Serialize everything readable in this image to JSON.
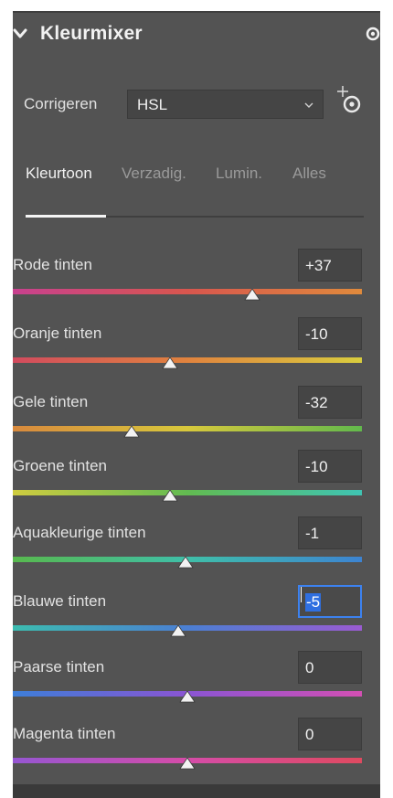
{
  "panel": {
    "title": "Kleurmixer",
    "collapse_icon": "chevron-down-icon",
    "visibility_icon": "eye-icon"
  },
  "correct": {
    "label": "Corrigeren",
    "selected": "HSL",
    "target_tool_icon": "targeted-adjustment-icon"
  },
  "tabs": [
    {
      "label": "Kleurtoon",
      "active": true
    },
    {
      "label": "Verzadig.",
      "active": false
    },
    {
      "label": "Lumin.",
      "active": false
    },
    {
      "label": "Alles",
      "active": false
    }
  ],
  "sliders": [
    {
      "label": "Rode tinten",
      "value": "+37",
      "level": 37,
      "colors": [
        "#c8418f",
        "#d8564e",
        "#e08a3c"
      ]
    },
    {
      "label": "Oranje tinten",
      "value": "-10",
      "level": -10,
      "colors": [
        "#d24b5e",
        "#e0833e",
        "#d9cd3e"
      ]
    },
    {
      "label": "Gele tinten",
      "value": "-32",
      "level": -32,
      "colors": [
        "#d8893d",
        "#d8c83c",
        "#62b94c"
      ]
    },
    {
      "label": "Groene tinten",
      "value": "-10",
      "level": -10,
      "colors": [
        "#cfcc40",
        "#62bb51",
        "#3fc4b3"
      ]
    },
    {
      "label": "Aquakleurige tinten",
      "value": "-1",
      "level": -1,
      "colors": [
        "#58b94e",
        "#3fbfa8",
        "#3d84d2"
      ]
    },
    {
      "label": "Blauwe tinten",
      "value": "-5",
      "level": -5,
      "focused": true,
      "colors": [
        "#3cbcb0",
        "#4b7fd3",
        "#9a5bd2"
      ]
    },
    {
      "label": "Paarse tinten",
      "value": "0",
      "level": 0,
      "colors": [
        "#3d7ed8",
        "#8a55d3",
        "#d34fb3"
      ]
    },
    {
      "label": "Magenta tinten",
      "value": "0",
      "level": 0,
      "colors": [
        "#9656d2",
        "#d54ca8",
        "#df4a60"
      ]
    }
  ],
  "colors": {
    "panel_bg": "#535353",
    "input_bg": "#454545",
    "focus_accent": "#3c82f0"
  }
}
